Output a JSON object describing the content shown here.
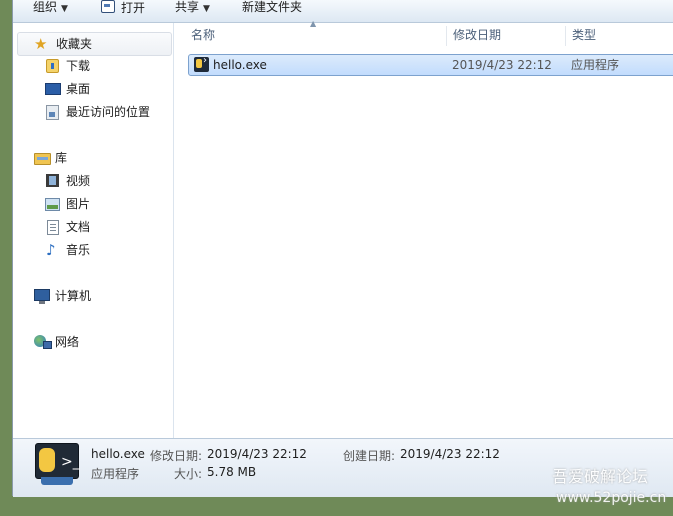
{
  "toolbar": {
    "organize": "组织",
    "open": "打开",
    "share": "共享",
    "new_folder": "新建文件夹"
  },
  "nav": {
    "favorites": {
      "label": "收藏夹",
      "items": [
        "下载",
        "桌面",
        "最近访问的位置"
      ]
    },
    "libraries": {
      "label": "库",
      "items": [
        "视频",
        "图片",
        "文档",
        "音乐"
      ]
    },
    "computer": "计算机",
    "network": "网络"
  },
  "columns": {
    "name": "名称",
    "modified": "修改日期",
    "type": "类型"
  },
  "files": [
    {
      "name": "hello.exe",
      "modified": "2019/4/23 22:12",
      "type": "应用程序"
    }
  ],
  "details": {
    "name": "hello.exe",
    "type": "应用程序",
    "modified_label": "修改日期:",
    "modified": "2019/4/23 22:12",
    "created_label": "创建日期:",
    "created": "2019/4/23 22:12",
    "size_label": "大小:",
    "size": "5.78 MB"
  },
  "watermark": {
    "line1": "吾爱破解论坛",
    "line2": "www.52pojie.cn"
  }
}
